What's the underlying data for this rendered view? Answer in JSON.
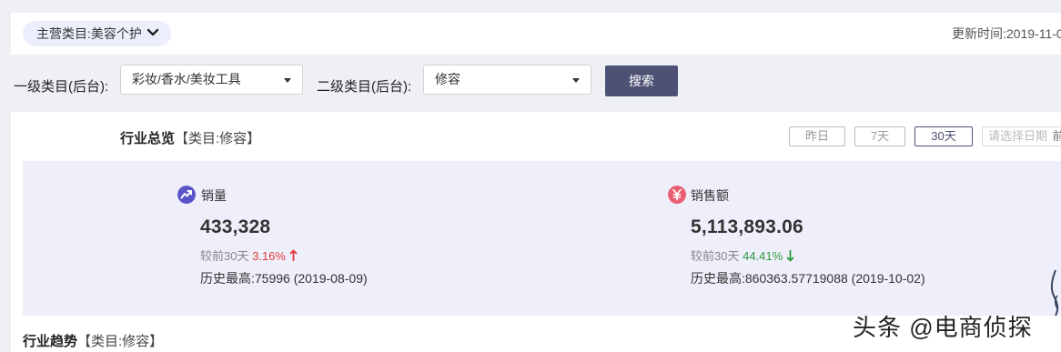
{
  "header": {
    "category_pill": "主营类目:美容个护",
    "update_time": "更新时间:2019-11-0"
  },
  "filters": {
    "level1_label": "一级类目(后台):",
    "level1_value": "彩妆/香水/美妆工具",
    "level2_label": "二级类目(后台):",
    "level2_value": "修容",
    "search_label": "搜索"
  },
  "overview": {
    "title": "行业总览",
    "subtitle": "【类目:修容】",
    "ranges": [
      "昨日",
      "7天",
      "30天"
    ],
    "active_range": "30天",
    "date_placeholder": "请选择日期",
    "date_fragment": "前"
  },
  "metrics": {
    "sales_volume": {
      "label": "销量",
      "value": "433,328",
      "compare_label": "较前30天",
      "change": "3.16%",
      "direction": "up",
      "history": "历史最高:75996 (2019-08-09)",
      "icon": "trend-icon",
      "icon_color": "#5a52c8"
    },
    "sales_amount": {
      "label": "销售额",
      "value": "5,113,893.06",
      "compare_label": "较前30天",
      "change": "44.41%",
      "direction": "down",
      "history": "历史最高:860363.57719088 (2019-10-02)",
      "icon": "yen-icon",
      "icon_color": "#e85d70"
    }
  },
  "trend": {
    "title": "行业趋势",
    "subtitle": "【类目:修容】"
  },
  "watermark": "头条 @电商侦探",
  "colors": {
    "accent": "#4d5275",
    "panel": "#eeeffa",
    "up": "#e03a3a",
    "down": "#2d9a3f"
  }
}
